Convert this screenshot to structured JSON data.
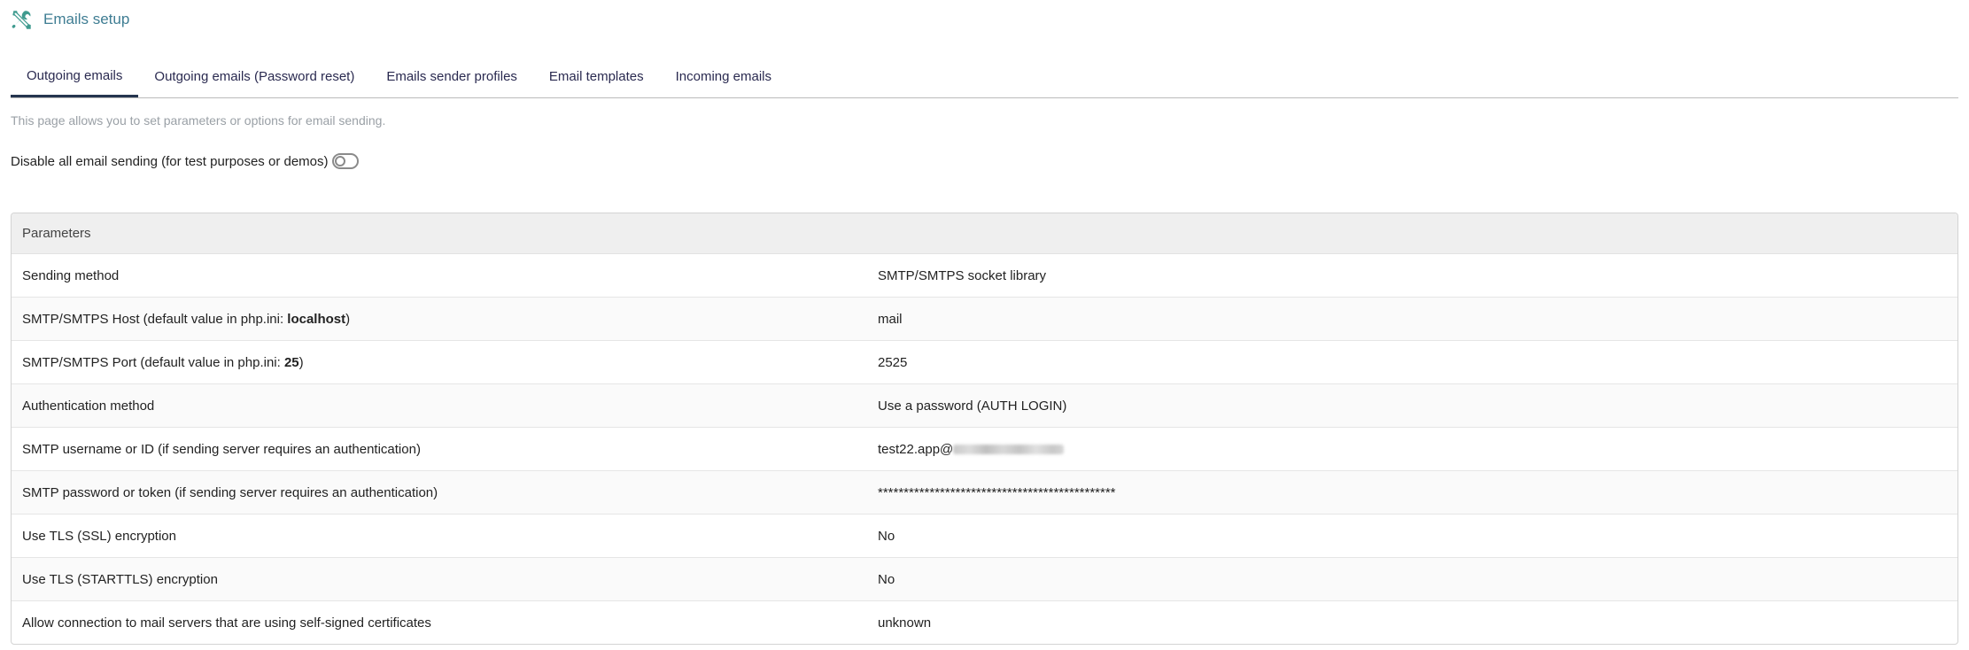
{
  "header": {
    "title": "Emails setup",
    "icon": "tools-icon",
    "icon_color": "#3f9b8f"
  },
  "tabs": [
    {
      "label": "Outgoing emails",
      "active": true
    },
    {
      "label": "Outgoing emails (Password reset)",
      "active": false
    },
    {
      "label": "Emails sender profiles",
      "active": false
    },
    {
      "label": "Email templates",
      "active": false
    },
    {
      "label": "Incoming emails",
      "active": false
    }
  ],
  "description": "This page allows you to set parameters or options for email sending.",
  "disable_sending": {
    "label": "Disable all email sending (for test purposes or demos)",
    "enabled": false
  },
  "params": {
    "header": "Parameters",
    "rows": [
      {
        "label": "Sending method",
        "value": "SMTP/SMTPS socket library"
      },
      {
        "label_prefix": "SMTP/SMTPS Host (default value in php.ini: ",
        "label_bold": "localhost",
        "label_suffix": ")",
        "value": "mail"
      },
      {
        "label_prefix": "SMTP/SMTPS Port (default value in php.ini: ",
        "label_bold": "25",
        "label_suffix": ")",
        "value": "2525"
      },
      {
        "label": "Authentication method",
        "value": "Use a password (AUTH LOGIN)"
      },
      {
        "label": "SMTP username or ID (if sending server requires an authentication)",
        "value": "test22.app@"
      },
      {
        "label": "SMTP password or token (if sending server requires an authentication)",
        "value": "**********************************************"
      },
      {
        "label": "Use TLS (SSL) encryption",
        "value": "No"
      },
      {
        "label": "Use TLS (STARTTLS) encryption",
        "value": "No"
      },
      {
        "label": "Allow connection to mail servers that are using self-signed certificates",
        "value": "unknown"
      }
    ]
  }
}
